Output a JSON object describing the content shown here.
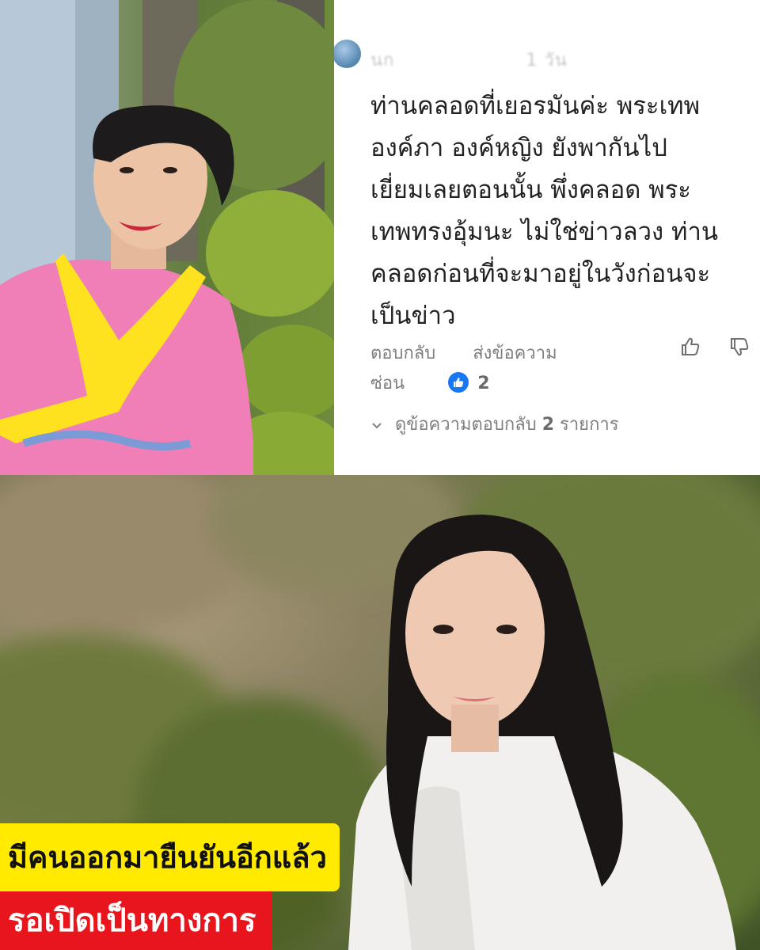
{
  "comment": {
    "author": "นก",
    "age": "1 วัน",
    "lines": [
      "ท่านคลอดที่เยอรมันค่ะ พระเทพ",
      "องค์ภา องค์หญิง ยังพากันไป",
      "เยี่ยมเลยตอนนั้น พึ่งคลอด พระ",
      "เทพทรงอุ้มนะ ไม่ใช่ข่าวลวง ท่าน",
      "คลอดก่อนที่จะมาอยู่ในวังก่อนจะ",
      "เป็นข่าว"
    ],
    "actions": {
      "reply": "ตอบกลับ",
      "message": "ส่งข้อความ",
      "hide": "ซ่อน"
    },
    "reaction_count": "2",
    "view_replies_prefix": "ดูข้อความตอบกลับ",
    "view_replies_count": "2",
    "view_replies_suffix": "รายการ"
  },
  "captions": {
    "yellow": "มีคนออกมายืนยันอีกแล้ว",
    "red": "รอเปิดเป็นทางการ"
  },
  "colors": {
    "caption_yellow": "#ffea00",
    "caption_red": "#e8161c",
    "reaction_blue": "#1877f2"
  },
  "icons": {
    "avatar": "avatar",
    "like": "thumbs-up-icon",
    "dislike": "thumbs-down-icon",
    "reaction": "like-reaction-icon",
    "expand": "chevron-down-icon"
  }
}
